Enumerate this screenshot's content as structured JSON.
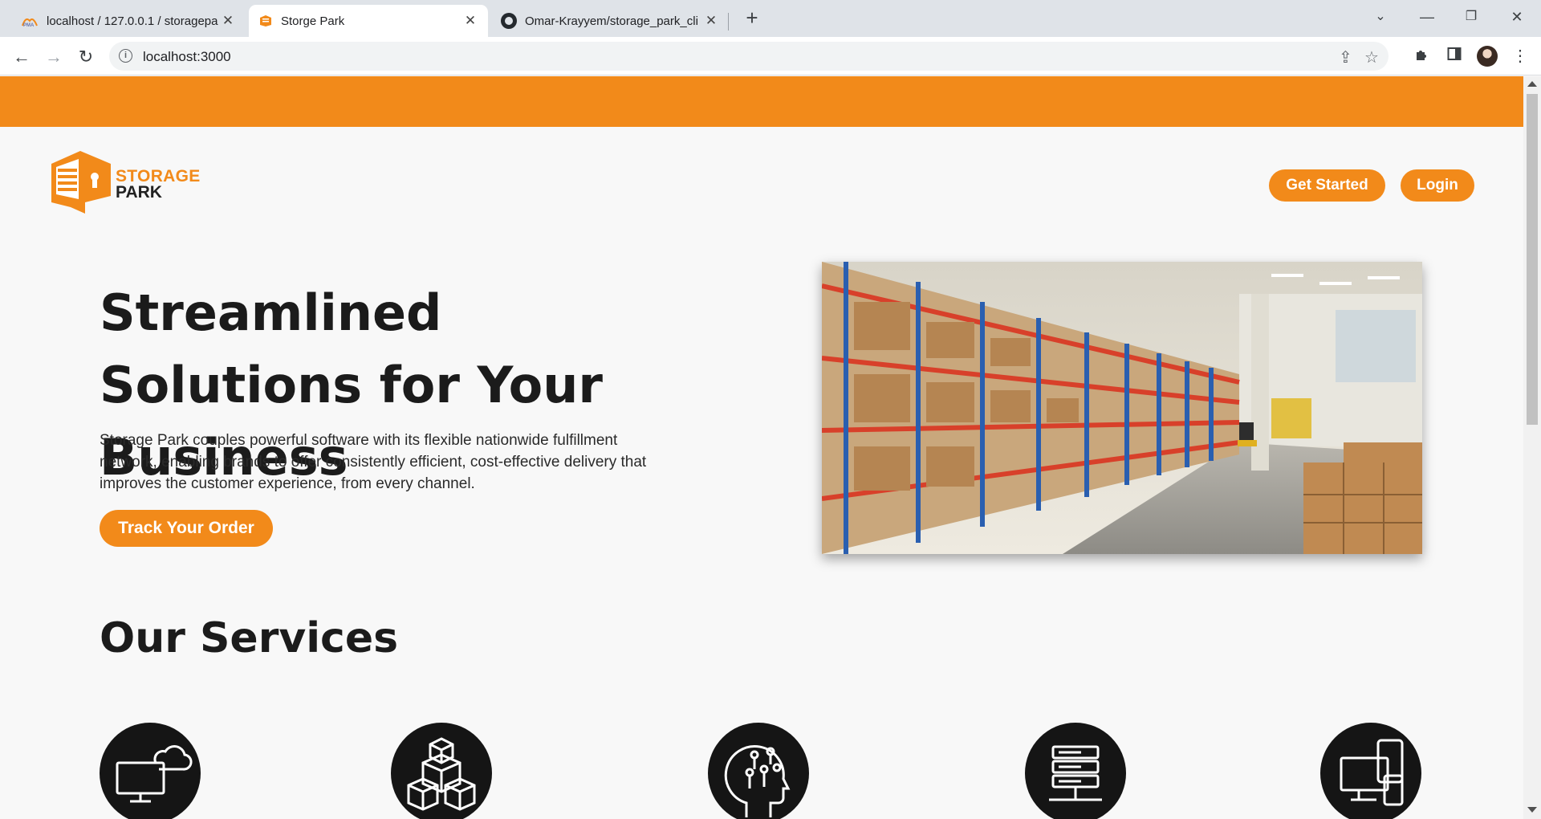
{
  "browser": {
    "tabs": [
      {
        "title": "localhost / 127.0.0.1 / storagepa",
        "icon": "phpmyadmin-icon",
        "active": false
      },
      {
        "title": "Storge Park",
        "icon": "storage-park-favicon",
        "active": true
      },
      {
        "title": "Omar-Krayyem/storage_park_cli",
        "icon": "github-icon",
        "active": false
      }
    ],
    "address": "localhost:3000"
  },
  "header": {
    "logo_line1": "STORAGE",
    "logo_line2": "PARK",
    "get_started_label": "Get Started",
    "login_label": "Login"
  },
  "hero": {
    "title": "Streamlined Solutions for Your Business",
    "description": "Storage Park couples powerful software with its flexible nationwide fulfillment network, enabling brands to offer consistently efficient, cost-effective delivery that improves the customer experience, from every channel.",
    "cta_label": "Track Your Order",
    "image": "warehouse-shelves-photo"
  },
  "services": {
    "title": "Our Services",
    "items": [
      {
        "icon": "cloud-computer-icon"
      },
      {
        "icon": "stacked-boxes-icon"
      },
      {
        "icon": "ai-brain-icon"
      },
      {
        "icon": "server-icon"
      },
      {
        "icon": "devices-icon"
      }
    ]
  },
  "colors": {
    "accent": "#f28a1a",
    "text_dark": "#1b1b1b",
    "icon_circle": "#151515"
  }
}
